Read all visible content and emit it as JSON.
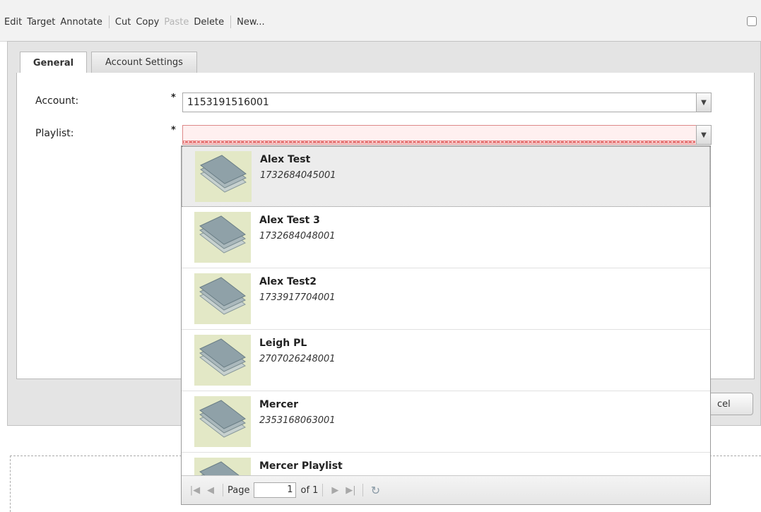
{
  "toolbar": {
    "edit": "Edit",
    "target": "Target",
    "annotate": "Annotate",
    "cut": "Cut",
    "copy": "Copy",
    "paste": "Paste",
    "delete": "Delete",
    "new": "New..."
  },
  "tabs": {
    "general": "General",
    "account_settings": "Account Settings"
  },
  "form": {
    "account_label": "Account:",
    "account_value": "1153191516001",
    "playlist_label": "Playlist:",
    "required_marker": "*",
    "playlist_value": ""
  },
  "buttons": {
    "cancel_partial": "cel"
  },
  "dropdown": {
    "items": [
      {
        "name": "Alex Test",
        "id": "1732684045001",
        "selected": true
      },
      {
        "name": "Alex Test 3",
        "id": "1732684048001"
      },
      {
        "name": "Alex Test2",
        "id": "1733917704001"
      },
      {
        "name": "Leigh PL",
        "id": "2707026248001"
      },
      {
        "name": "Mercer",
        "id": "2353168063001"
      },
      {
        "name": "Mercer Playlist",
        "id": ""
      }
    ],
    "pager": {
      "page_label": "Page",
      "page_value": "1",
      "of_label": "of 1"
    }
  },
  "icons": {
    "playlist_thumb": "stacked-layers-icon",
    "first": "first-page-icon",
    "prev": "prev-page-icon",
    "next": "next-page-icon",
    "last": "last-page-icon",
    "refresh": "refresh-icon"
  }
}
